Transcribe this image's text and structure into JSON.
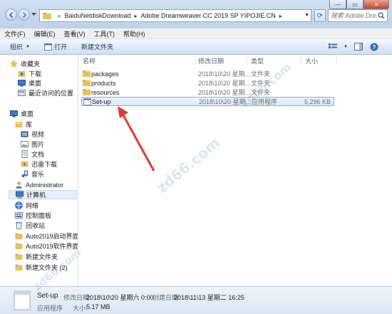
{
  "window": {
    "minimize_label": "—",
    "maximize_label": "▭",
    "close_label": "✕"
  },
  "address_bar": {
    "segments": [
      "BaiduNetdiskDownload",
      "Adobe Dreamweaver CC 2019 SP YIPOJIE.CN"
    ],
    "search_placeholder": "搜索 Adobe Dre..."
  },
  "menu": [
    "文件(F)",
    "编辑(E)",
    "查看(V)",
    "工具(T)",
    "帮助(H)"
  ],
  "toolbar": {
    "organize_label": "组织",
    "open_label": "打开",
    "new_folder_label": "新建文件夹"
  },
  "nav_pane": {
    "items": [
      {
        "label": "收藏夹",
        "icon": "star-icon"
      },
      {
        "label": "下载",
        "icon": "download-folder-icon"
      },
      {
        "label": "桌面",
        "icon": "desktop-icon"
      },
      {
        "label": "最近访问的位置",
        "icon": "recent-places-icon"
      },
      {
        "label": "桌面",
        "icon": "desktop-icon"
      },
      {
        "label": "库",
        "icon": "library-icon"
      },
      {
        "label": "视频",
        "icon": "video-icon"
      },
      {
        "label": "图片",
        "icon": "pictures-icon"
      },
      {
        "label": "文档",
        "icon": "documents-icon"
      },
      {
        "label": "迅雷下载",
        "icon": "thunder-download-icon"
      },
      {
        "label": "音乐",
        "icon": "music-icon"
      },
      {
        "label": "Administrator",
        "icon": "user-icon"
      },
      {
        "label": "计算机",
        "icon": "computer-icon"
      },
      {
        "label": "网络",
        "icon": "network-icon"
      },
      {
        "label": "控制面板",
        "icon": "control-panel-icon"
      },
      {
        "label": "回收站",
        "icon": "recycle-bin-icon"
      },
      {
        "label": "Auto2019启动界面",
        "icon": "folder-icon"
      },
      {
        "label": "Auto2019软件界面",
        "icon": "folder-icon"
      },
      {
        "label": "新建文件夹",
        "icon": "folder-icon"
      },
      {
        "label": "新建文件夹 (2)",
        "icon": "folder-icon"
      }
    ]
  },
  "file_list": {
    "columns": [
      "名称",
      "修改日期",
      "类型",
      "大小"
    ],
    "rows": [
      {
        "name": "packages",
        "date": "2018\\10\\20 星期...",
        "type": "文件夹",
        "size": "",
        "icon": "folder-icon"
      },
      {
        "name": "products",
        "date": "2018\\10\\20 星期...",
        "type": "文件夹",
        "size": "",
        "icon": "folder-icon"
      },
      {
        "name": "resources",
        "date": "2018\\10\\20 星期...",
        "type": "文件夹",
        "size": "",
        "icon": "folder-icon"
      },
      {
        "name": "Set-up",
        "date": "2018\\10\\20 星期...",
        "type": "应用程序",
        "size": "5,296 KB",
        "icon": "application-icon"
      }
    ]
  },
  "details": {
    "name": "Set-up",
    "type": "应用程序",
    "modified_label": "修改日期:",
    "modified_value": "2018\\10\\20 星期六 0:00",
    "created_label": "创建日期:",
    "created_value": "2018\\11\\13 星期二 16:25",
    "size_label": "大小:",
    "size_value": "5.17 MB"
  },
  "watermark_text": "zd66.com",
  "colors": {
    "accent": "#3b7bd1",
    "arrow": "#e23b2e",
    "folder": "#e8c15a"
  }
}
